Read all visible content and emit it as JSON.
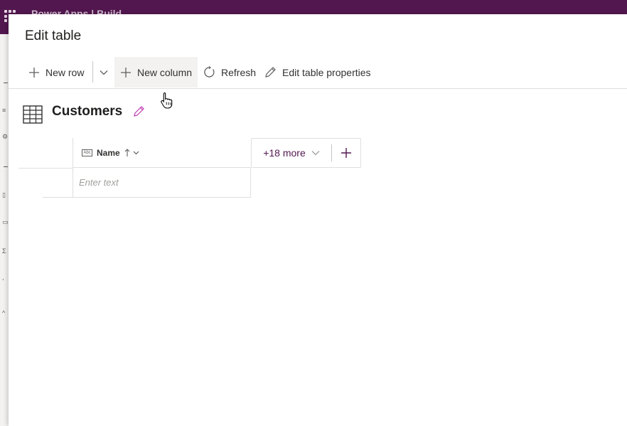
{
  "background_app": {
    "title_partial": "Power Apps | Build"
  },
  "panel": {
    "title": "Edit table"
  },
  "commandbar": {
    "new_row": "New row",
    "new_column": "New column",
    "refresh": "Refresh",
    "edit_properties": "Edit table properties"
  },
  "table": {
    "name": "Customers",
    "columns": [
      {
        "label": "Name",
        "type_icon": "Abc",
        "sort": "ascending"
      }
    ],
    "more_columns": "+18 more",
    "rows": [
      {
        "name_placeholder": "Enter text"
      }
    ]
  },
  "colors": {
    "brand": "#52174f",
    "accent_pencil": "#c239b3"
  }
}
